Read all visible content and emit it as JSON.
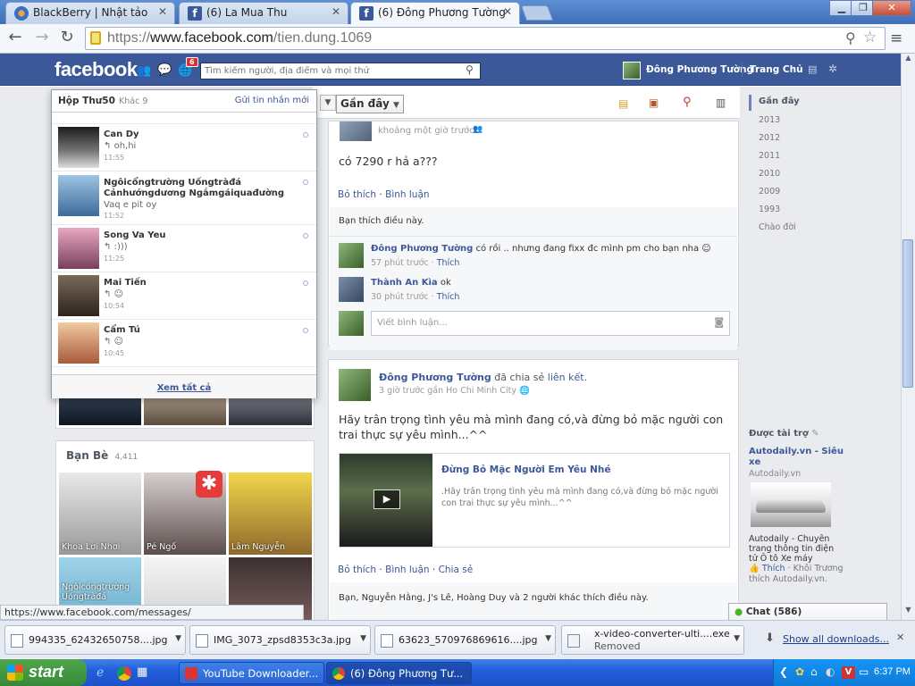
{
  "browser": {
    "tabs": [
      {
        "title": "BlackBerry | Nhật tảo"
      },
      {
        "title": "(6) La Mua Thu"
      },
      {
        "title": "(6) Đông Phương Tường"
      }
    ],
    "url_scheme": "https://",
    "url_host": "www.facebook.com",
    "url_path": "/tien.dung.1069",
    "status_url": "https://www.facebook.com/messages/"
  },
  "fb": {
    "logo": "facebook",
    "notif_count": "6",
    "search_placeholder": "Tìm kiếm người, địa điểm và mọi thứ",
    "user_name": "Đông Phương Tường",
    "home_label": "Trang Chủ"
  },
  "messages": {
    "header_title": "Hộp Thư",
    "header_count": "50",
    "other_label": "Khác",
    "other_count": "9",
    "send_new": "Gửi tin nhắn mới",
    "see_all": "Xem tất cả",
    "items": [
      {
        "name": "Can Dy",
        "snippet": "oh,hi",
        "time": "11:55"
      },
      {
        "name": "Ngôicổngtrường Uốngtràđá Cảnhướngdương Ngắmgáiquađường",
        "snippet": "Vaq e pit oy",
        "time": "11:52"
      },
      {
        "name": "Song Va Yeu",
        "snippet": ":)))",
        "time": "11:25"
      },
      {
        "name": "Mai Tiến",
        "snippet": "☺",
        "time": "10:54"
      },
      {
        "name": "Cẩm Tú",
        "snippet": "☺",
        "time": "10:45"
      }
    ]
  },
  "left": {
    "friends_title": "Bạn Bè",
    "friends_count": "4,411",
    "friends": [
      {
        "name": "Khoa Lơi Nhơi"
      },
      {
        "name": "Pé Ngố"
      },
      {
        "name": "Lâm Nguyễn"
      },
      {
        "name": "Ngôicổngtrường Uốngtràđá"
      },
      {
        "name": ""
      },
      {
        "name": ""
      }
    ]
  },
  "timeline": {
    "recent_label": "Gần đây",
    "years": [
      "Gần đây",
      "2013",
      "2012",
      "2011",
      "2010",
      "2009",
      "1993",
      "Chào đời"
    ]
  },
  "post1": {
    "time": "khoảng một giờ trước",
    "text": "có 7290 r hả a???",
    "action_unlike": "Bỏ thích",
    "action_comment": "Bình luận",
    "likes_text": "Bạn thích điều này.",
    "comments": [
      {
        "name": "Đông Phương Tường",
        "text": "có rồi .. nhưng đang fixx đc mình pm cho bạn nha ☺",
        "time": "57 phút trước",
        "like": "Thích"
      },
      {
        "name": "Thành An Kìa",
        "text": "ok",
        "time": "30 phút trước",
        "like": "Thích"
      }
    ],
    "comment_placeholder": "Viết bình luận..."
  },
  "post2": {
    "author": "Đông Phương Tường",
    "shared_text": "đã chia sẻ",
    "shared_link": "liên kết.",
    "time": "3 giờ trước gần Ho Chi Minh City",
    "text": "Hãy trân trọng tình yêu mà mình đang có,và đừng bỏ mặc người con trai thực sự yêu mình...^^",
    "link_title": "Đừng Bỏ Mặc Người Em Yêu Nhé",
    "link_desc": ".Hãy trân trọng tình yêu mà mình đang có,và đừng bỏ mặc người con trai thực sự yêu mình...^^",
    "action_unlike": "Bỏ thích",
    "action_comment": "Bình luận",
    "action_share": "Chia sẻ",
    "likes_text": "Bạn, Nguyễn Hằng, J's Lê, Hoàng Duy và 2 người khác thích điều này."
  },
  "ads": {
    "header": "Được tài trợ",
    "title": "Autodaily.vn - Siêu xe",
    "domain": "Autodaily.vn",
    "desc": "Autodaily - Chuyên trang thông tin điện tử Ô tô Xe máy",
    "like": "Thích",
    "meta": " · Khôi Trương thích Autodaily.vn."
  },
  "chat": {
    "label": "Chat (586)"
  },
  "downloads": {
    "items": [
      {
        "name": "994335_62432650758....jpg"
      },
      {
        "name": "IMG_3073_zpsd8353c3a.jpg"
      },
      {
        "name": "63623_570976869616....jpg"
      },
      {
        "name": "x-video-converter-ulti....exe",
        "status": "Removed"
      }
    ],
    "show_all": "Show all downloads..."
  },
  "taskbar": {
    "start": "start",
    "tasks": [
      {
        "label": "YouTube Downloader..."
      },
      {
        "label": "(6) Đông Phương Tư..."
      }
    ],
    "clock": "6:37 PM"
  },
  "colors": {
    "fb_blue": "#3b5998",
    "link": "#3b5998",
    "xp_blue": "#245edb",
    "start_green": "#3c9a3c"
  }
}
